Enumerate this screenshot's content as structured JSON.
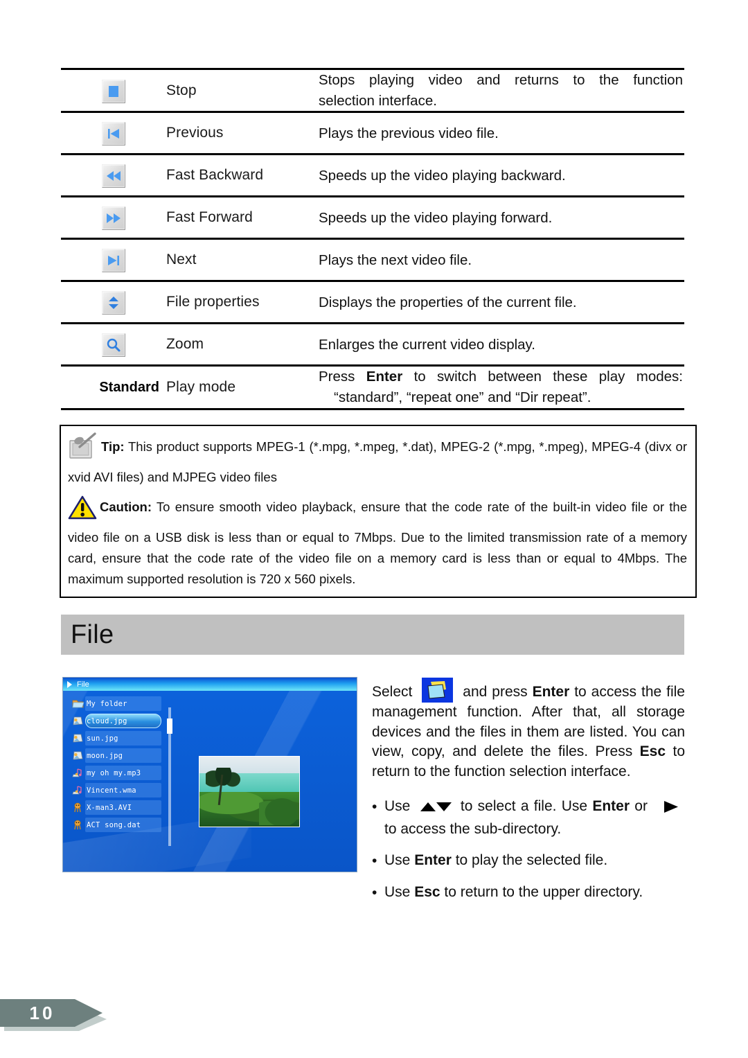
{
  "table": {
    "rows": [
      {
        "icon": "stop-icon",
        "label": "Stop",
        "desc_lines": [
          "Stops playing video and returns to the function",
          "selection interface."
        ]
      },
      {
        "icon": "previous-icon",
        "label": "Previous",
        "desc_lines": [
          "Plays the previous video file."
        ]
      },
      {
        "icon": "fast-backward-icon",
        "label": "Fast Backward",
        "desc_lines": [
          "Speeds up the video playing backward."
        ]
      },
      {
        "icon": "fast-forward-icon",
        "label": "Fast Forward",
        "desc_lines": [
          "Speeds up the video playing forward."
        ]
      },
      {
        "icon": "next-icon",
        "label": "Next",
        "desc_lines": [
          "Plays the next video file."
        ]
      },
      {
        "icon": "file-properties-icon",
        "label": "File properties",
        "desc_lines": [
          "Displays the properties of the current file."
        ]
      },
      {
        "icon": "zoom-icon",
        "label": "Zoom",
        "desc_lines": [
          "Enlarges the current video display."
        ]
      }
    ],
    "play_mode_row": {
      "mode_value": "Standard",
      "label": "Play mode",
      "desc_prefix": "Press ",
      "desc_key": "Enter",
      "desc_mid": " to switch between these play modes:",
      "desc_line2": "“standard”, “repeat one” and “Dir repeat”."
    }
  },
  "notebox": {
    "tip_icon": "notepad-pen-icon",
    "tip_label": "Tip:",
    "tip_text": " This product supports MPEG-1 (*.mpg, *.mpeg, *.dat), MPEG-2 (*.mpg, *.mpeg), MPEG-4 (divx or xvid AVI files) and MJPEG video files",
    "caution_icon": "warning-triangle-icon",
    "caution_label": "Caution:",
    "caution_text": "   To ensure smooth video playback, ensure that the code rate of the built-in video file or the video file on a USB disk is less than or equal to 7Mbps.   Due to the limited transmission rate of a memory card, ensure that the code rate of the video file on a memory card is less than or equal to 4Mbps.   The maximum supported resolution is 720 x 560 pixels."
  },
  "section": {
    "heading": "File",
    "heading_bg": "#c0c0c0"
  },
  "device_screenshot": {
    "titlebar": "File",
    "files": [
      {
        "name": "My folder",
        "icon": "folder-icon",
        "selected": false
      },
      {
        "name": "cloud.jpg",
        "icon": "image-icon",
        "selected": true
      },
      {
        "name": "sun.jpg",
        "icon": "image-icon",
        "selected": false
      },
      {
        "name": "moon.jpg",
        "icon": "image-icon",
        "selected": false
      },
      {
        "name": "my oh my.mp3",
        "icon": "music-icon",
        "selected": false
      },
      {
        "name": "Vincent.wma",
        "icon": "music-icon",
        "selected": false
      },
      {
        "name": "X-man3.AVI",
        "icon": "video-icon",
        "selected": false
      },
      {
        "name": "ACT song.dat",
        "icon": "video-icon",
        "selected": false
      }
    ],
    "preview_alt": "beach-photo-preview"
  },
  "side_text": {
    "p1_a": "Select ",
    "p1_icon": "file-manager-icon",
    "p1_b": " and press ",
    "p1_key1": "Enter",
    "p1_c": " to access the file management function. After that, all storage devices and the files in them are listed. You can view, copy, and delete the files. Press ",
    "p1_key2": "Esc",
    "p1_d": " to return to the function selection interface.",
    "bullets": [
      {
        "dot": "•",
        "a": "Use ",
        "icon": "up-down-arrows-icon",
        "b": " to select a file. Use ",
        "key": "Enter",
        "c": " or",
        "icon2": "right-arrow-icon",
        "d": " to access the sub-directory."
      },
      {
        "dot": "•",
        "a": "Use ",
        "key": "Enter",
        "c": " to play the selected file."
      },
      {
        "dot": "•",
        "a": "Use ",
        "key": "Esc",
        "c": " to return to the upper directory."
      }
    ]
  },
  "footer": {
    "page_number": "10",
    "arrow_color": "#6d807e",
    "shadow_color": "#c2cdcb"
  }
}
